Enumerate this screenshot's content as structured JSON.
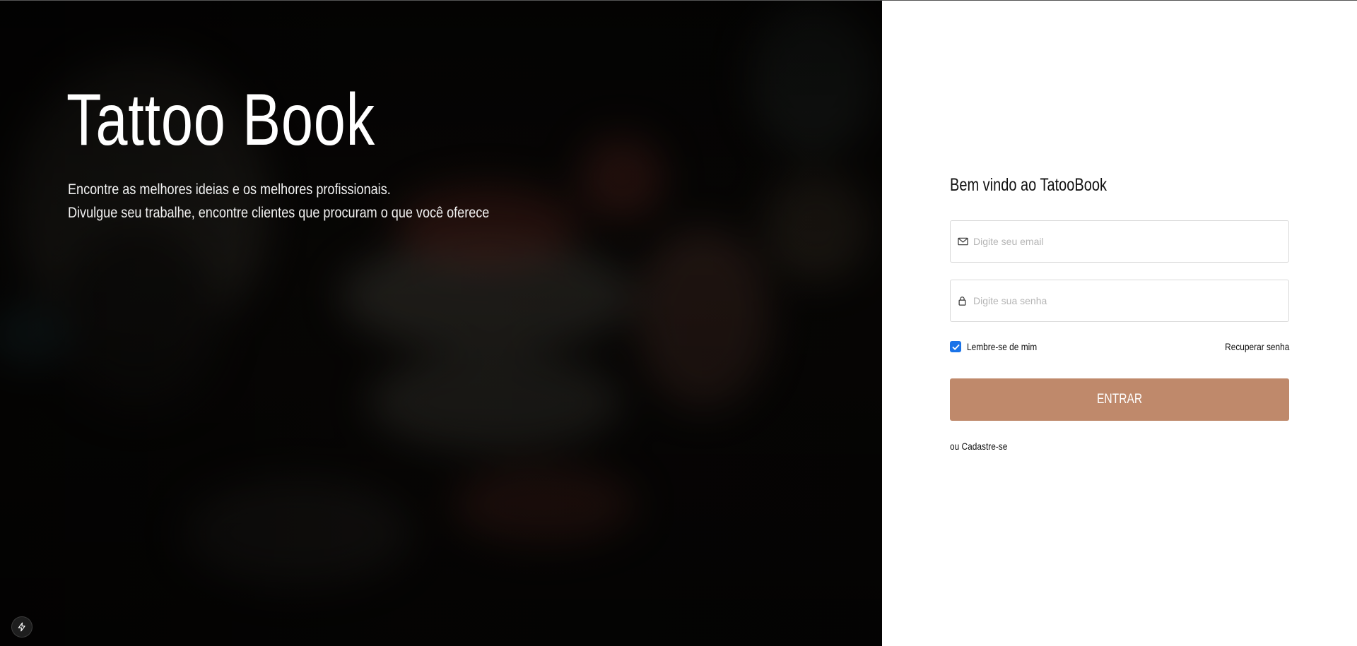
{
  "hero": {
    "title": "Tattoo Book",
    "subtitle_line1": "Encontre as melhores ideias e os melhores profissionais.",
    "subtitle_line2": "Divulgue seu trabalhe, encontre clientes que procuram o que você oferece"
  },
  "login": {
    "welcome": "Bem vindo ao TatooBook",
    "email_placeholder": "Digite seu email",
    "password_placeholder": "Digite sua senha",
    "remember_label": "Lembre-se de mim",
    "remember_checked": true,
    "recover_label": "Recuperar senha",
    "submit_label": "ENTRAR",
    "signup_label": "ou Cadastre-se"
  },
  "icons": {
    "email": "envelope-icon",
    "password": "lock-icon",
    "remember": "checkmark-icon",
    "bottom_left": "lightning-bolt-icon"
  },
  "colors": {
    "accent": "#bf896b",
    "checkbox": "#1a73e8",
    "hero_background": "#0b0907"
  }
}
